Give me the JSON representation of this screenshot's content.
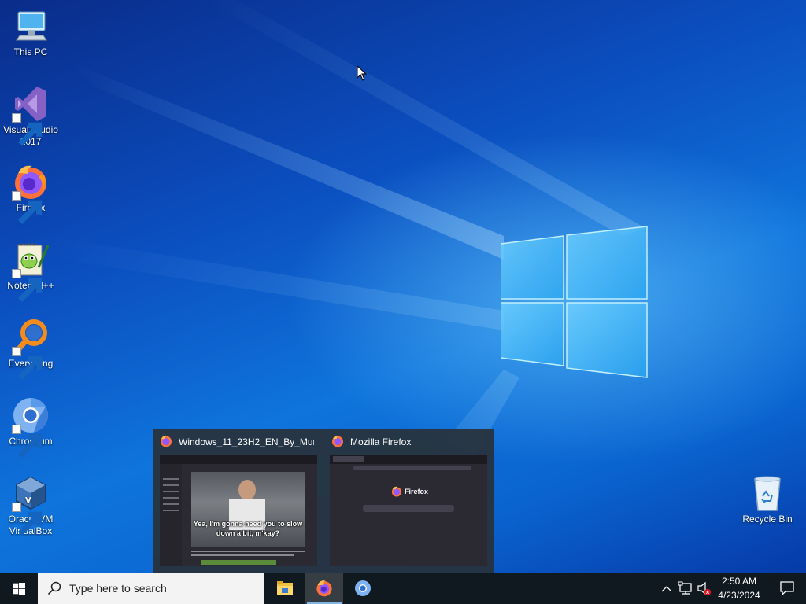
{
  "desktop": {
    "icons": [
      {
        "label": "This PC",
        "icon": "computer-icon"
      },
      {
        "label": "Visual Studio 2017",
        "icon": "visual-studio-icon"
      },
      {
        "label": "Firefox",
        "icon": "firefox-icon"
      },
      {
        "label": "Notepad++",
        "icon": "notepadpp-icon"
      },
      {
        "label": "Everything",
        "icon": "everything-search-icon"
      },
      {
        "label": "Chromium",
        "icon": "chromium-icon"
      },
      {
        "label": "Oracle VM VirtualBox",
        "icon": "virtualbox-icon"
      },
      {
        "label": "Recycle Bin",
        "icon": "recycle-bin-icon"
      }
    ]
  },
  "thumbnails": [
    {
      "title": "Windows_11_23H2_EN_By_Mur...",
      "preview_caption": "Yea, I'm gonna need you to slow down a bit, m'kay?"
    },
    {
      "title": "Mozilla Firefox",
      "preview_brand": "Firefox"
    }
  ],
  "taskbar": {
    "search_placeholder": "Type here to search",
    "apps": [
      "file-explorer-icon",
      "firefox-icon",
      "chromium-icon"
    ],
    "clock": {
      "time": "2:50 AM",
      "date": "4/23/2024"
    }
  },
  "colors": {
    "taskbar_bg": "#101820",
    "desktop_accent": "#0f74dc",
    "active_indicator": "#7fb6e6"
  }
}
